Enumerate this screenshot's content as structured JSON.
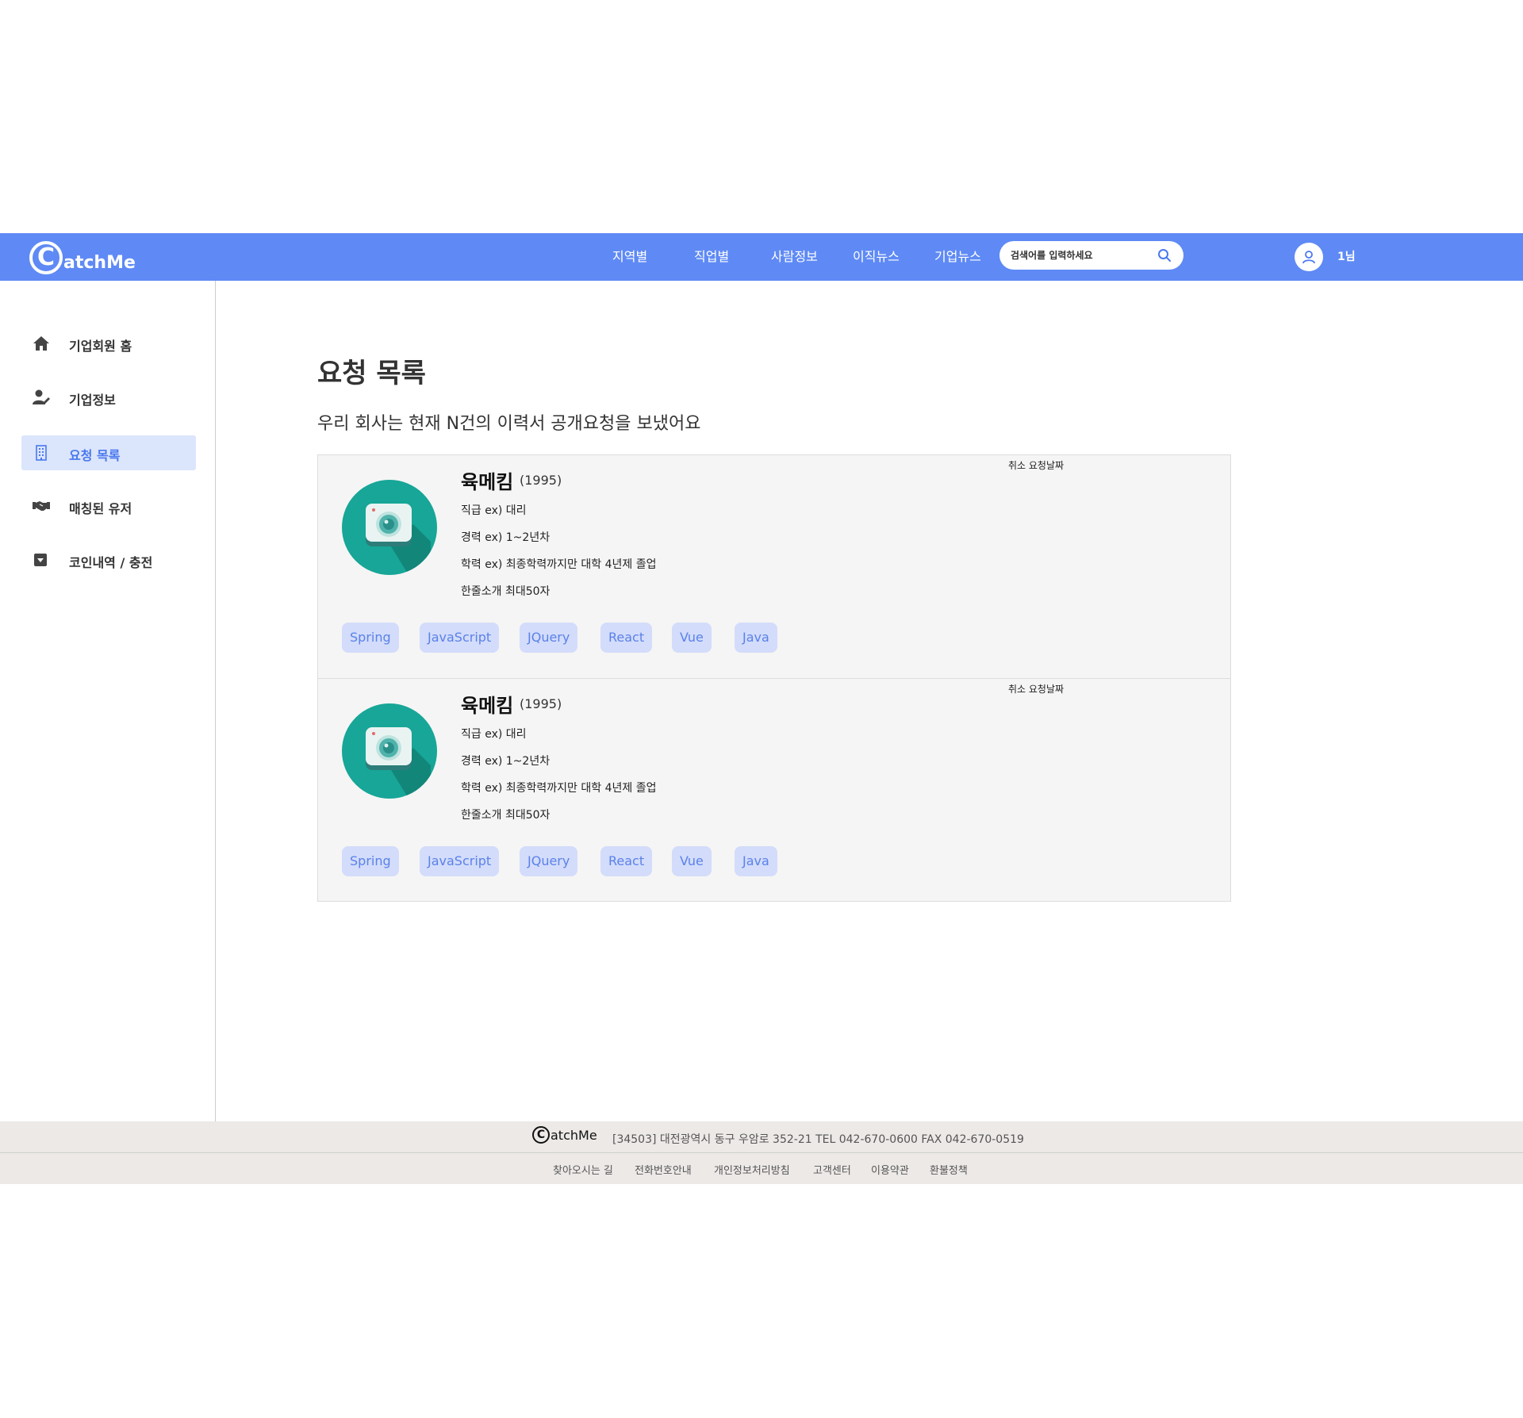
{
  "header": {
    "logo_initial": "C",
    "logo_rest": "atchMe",
    "nav": [
      "지역별",
      "직업별",
      "사람정보",
      "이직뉴스",
      "기업뉴스"
    ],
    "search_placeholder": "검색어를 입력하세요",
    "user_name": "1님",
    "accent_color": "#5f8af5"
  },
  "sidebar": {
    "items": [
      {
        "label": "기업회원 홈",
        "icon": "home-icon",
        "active": false
      },
      {
        "label": "기업정보",
        "icon": "user-edit-icon",
        "active": false
      },
      {
        "label": "요청 목록",
        "icon": "building-icon",
        "active": true
      },
      {
        "label": "매칭된 유저",
        "icon": "handshake-icon",
        "active": false
      },
      {
        "label": "코인내역 / 충전",
        "icon": "caret-square-down-icon",
        "active": false
      }
    ]
  },
  "main": {
    "title": "요청 목록",
    "subtitle": "우리 회사는 현재 N건의 이력서 공개요청을 보냈어요",
    "cards": [
      {
        "name": "육메킴",
        "birth_year": "(1995)",
        "position": "직급 ex) 대리",
        "career": "경력 ex) 1~2년차",
        "education": "학력 ex) 최종학력까지만 대학 4년제 졸업",
        "intro": "한줄소개 최대50자",
        "meta": "취소 요청날짜",
        "skills": [
          "Spring",
          "JavaScript",
          "JQuery",
          "React",
          "Vue",
          "Java"
        ]
      },
      {
        "name": "육메킴",
        "birth_year": "(1995)",
        "position": "직급 ex) 대리",
        "career": "경력 ex) 1~2년차",
        "education": "학력 ex) 최종학력까지만 대학 4년제 졸업",
        "intro": "한줄소개 최대50자",
        "meta": "취소 요청날짜",
        "skills": [
          "Spring",
          "JavaScript",
          "JQuery",
          "React",
          "Vue",
          "Java"
        ]
      }
    ]
  },
  "footer": {
    "logo_initial": "C",
    "logo_rest": "atchMe",
    "address": "[34503] 대전광역시 동구 우암로 352-21 TEL 042-670-0600 FAX 042-670-0519",
    "links": [
      "찾아오시는 길",
      "전화번호안내",
      "개인정보처리방침",
      "고객센터",
      "이용약관",
      "환불정책"
    ]
  }
}
